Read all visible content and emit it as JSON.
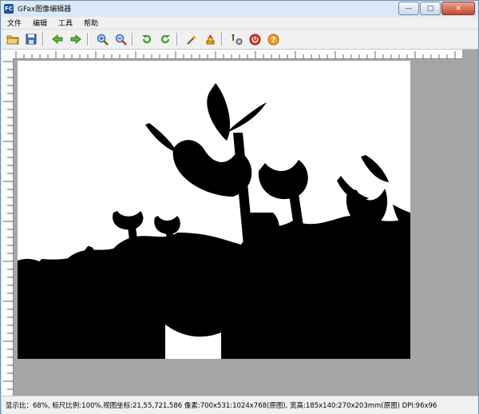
{
  "window": {
    "title": "GFax图像编辑器",
    "icon": "gfax-app-icon"
  },
  "window_controls": {
    "minimize": "—",
    "maximize": "□",
    "close": "✕"
  },
  "menubar": {
    "items": [
      {
        "label": "文件"
      },
      {
        "label": "编辑"
      },
      {
        "label": "工具"
      },
      {
        "label": "帮助"
      }
    ]
  },
  "toolbar": {
    "buttons": [
      {
        "icon": "open-folder-icon"
      },
      {
        "icon": "save-disk-icon"
      },
      {
        "icon": "arrow-left-icon"
      },
      {
        "icon": "arrow-right-icon"
      },
      {
        "icon": "zoom-in-icon"
      },
      {
        "icon": "zoom-out-icon"
      },
      {
        "icon": "rotate-left-icon"
      },
      {
        "icon": "rotate-right-icon"
      },
      {
        "icon": "wand-icon"
      },
      {
        "icon": "highlighter-icon"
      },
      {
        "icon": "tools-icon"
      },
      {
        "icon": "power-icon"
      },
      {
        "icon": "help-icon"
      }
    ]
  },
  "statusbar": {
    "text": "显示比：68%, 标尺比例:100%,视图坐标:21,55,721,586 像素:700x531:1024x768(原图), 宽高:185x140:270x203mm(原图) DPI:96x96"
  },
  "colors": {
    "titlebar": "#c9d9ec",
    "workspace": "#a6a6a6",
    "chrome": "#f0f0f0"
  }
}
